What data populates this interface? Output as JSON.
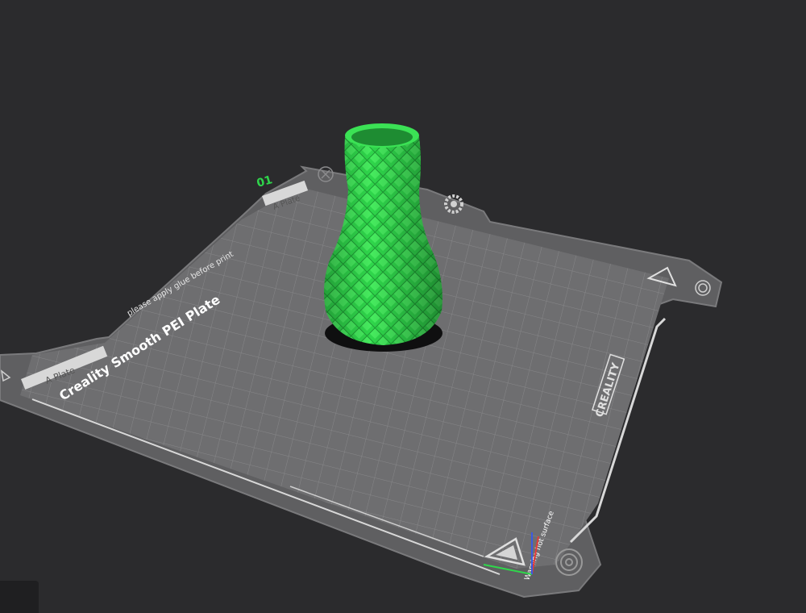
{
  "plate": {
    "index": "01",
    "title": "Creality Smooth PEI Plate",
    "side_left": "A Plate",
    "side_top": "A Plate",
    "glue_note": "please apply glue before print",
    "brand": "CREALITY",
    "warning": "Warning hot surface"
  },
  "icons": {
    "close": "close-icon",
    "gear": "gear-icon",
    "fingerprint": "fingerprint-icon",
    "warning": "warning-triangle-icon"
  },
  "colors": {
    "background": "#2b2b2d",
    "plate": "#6b6b6d",
    "grid": "#8a8a8c",
    "model": "#2fd64b",
    "plate_index": "#2fd64b"
  }
}
